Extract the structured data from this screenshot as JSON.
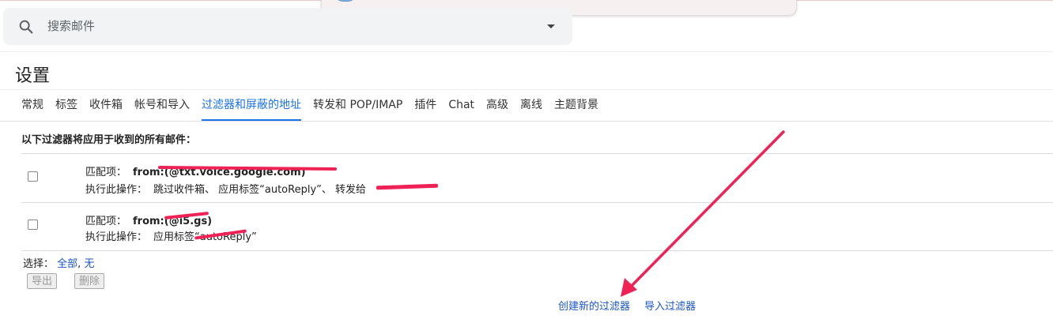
{
  "search": {
    "placeholder": "搜索邮件"
  },
  "page": {
    "title": "设置"
  },
  "tabs": [
    {
      "label": "常规"
    },
    {
      "label": "标签"
    },
    {
      "label": "收件箱"
    },
    {
      "label": "帐号和导入"
    },
    {
      "label": "过滤器和屏蔽的地址",
      "active": true
    },
    {
      "label": "转发和 POP/IMAP"
    },
    {
      "label": "插件"
    },
    {
      "label": "Chat"
    },
    {
      "label": "高级"
    },
    {
      "label": "离线"
    },
    {
      "label": "主题背景"
    }
  ],
  "filters": {
    "heading": "以下过滤器将应用于收到的所有邮件：",
    "rows": [
      {
        "criteria_label": "匹配项：",
        "criteria_value": "from:(@txt.voice.google.com)",
        "action_label": "执行此操作：",
        "action_value": "跳过收件箱、 应用标签“autoReply”、 转发给"
      },
      {
        "criteria_label": "匹配项：",
        "criteria_value": "from:(@i5.gs)",
        "action_label": "执行此操作：",
        "action_value": "应用标签“autoReply”"
      }
    ],
    "select_label": "选择：",
    "select_all": "全部",
    "select_sep": ",",
    "select_none": "无",
    "export_button": "导出",
    "delete_button": "删除",
    "create_link": "创建新的过滤器",
    "import_link": "导入过滤器"
  },
  "colors": {
    "accent": "#1a73e8",
    "link": "#1a55c8",
    "annotation_red": "#ee2255"
  }
}
